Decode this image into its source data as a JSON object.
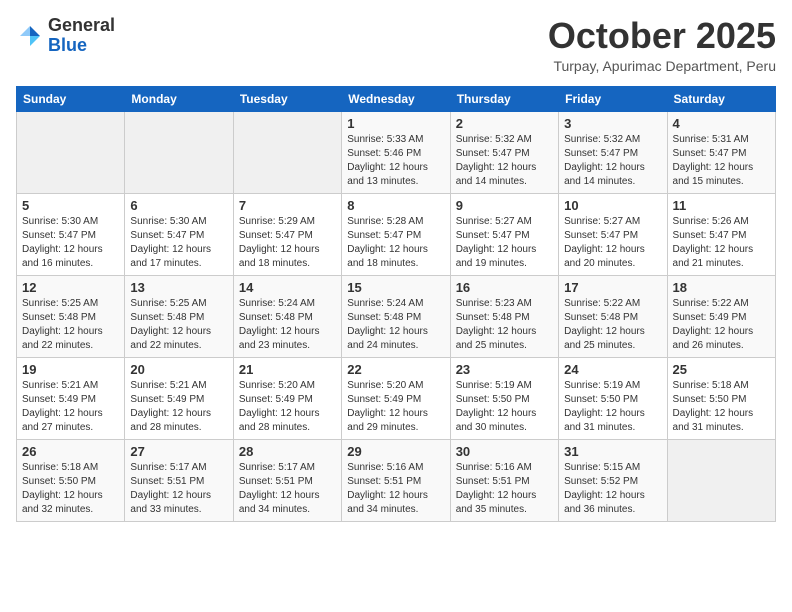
{
  "logo": {
    "general": "General",
    "blue": "Blue"
  },
  "header": {
    "month_title": "October 2025",
    "location": "Turpay, Apurimac Department, Peru"
  },
  "days_of_week": [
    "Sunday",
    "Monday",
    "Tuesday",
    "Wednesday",
    "Thursday",
    "Friday",
    "Saturday"
  ],
  "weeks": [
    [
      {
        "day": "",
        "info": ""
      },
      {
        "day": "",
        "info": ""
      },
      {
        "day": "",
        "info": ""
      },
      {
        "day": "1",
        "info": "Sunrise: 5:33 AM\nSunset: 5:46 PM\nDaylight: 12 hours\nand 13 minutes."
      },
      {
        "day": "2",
        "info": "Sunrise: 5:32 AM\nSunset: 5:47 PM\nDaylight: 12 hours\nand 14 minutes."
      },
      {
        "day": "3",
        "info": "Sunrise: 5:32 AM\nSunset: 5:47 PM\nDaylight: 12 hours\nand 14 minutes."
      },
      {
        "day": "4",
        "info": "Sunrise: 5:31 AM\nSunset: 5:47 PM\nDaylight: 12 hours\nand 15 minutes."
      }
    ],
    [
      {
        "day": "5",
        "info": "Sunrise: 5:30 AM\nSunset: 5:47 PM\nDaylight: 12 hours\nand 16 minutes."
      },
      {
        "day": "6",
        "info": "Sunrise: 5:30 AM\nSunset: 5:47 PM\nDaylight: 12 hours\nand 17 minutes."
      },
      {
        "day": "7",
        "info": "Sunrise: 5:29 AM\nSunset: 5:47 PM\nDaylight: 12 hours\nand 18 minutes."
      },
      {
        "day": "8",
        "info": "Sunrise: 5:28 AM\nSunset: 5:47 PM\nDaylight: 12 hours\nand 18 minutes."
      },
      {
        "day": "9",
        "info": "Sunrise: 5:27 AM\nSunset: 5:47 PM\nDaylight: 12 hours\nand 19 minutes."
      },
      {
        "day": "10",
        "info": "Sunrise: 5:27 AM\nSunset: 5:47 PM\nDaylight: 12 hours\nand 20 minutes."
      },
      {
        "day": "11",
        "info": "Sunrise: 5:26 AM\nSunset: 5:47 PM\nDaylight: 12 hours\nand 21 minutes."
      }
    ],
    [
      {
        "day": "12",
        "info": "Sunrise: 5:25 AM\nSunset: 5:48 PM\nDaylight: 12 hours\nand 22 minutes."
      },
      {
        "day": "13",
        "info": "Sunrise: 5:25 AM\nSunset: 5:48 PM\nDaylight: 12 hours\nand 22 minutes."
      },
      {
        "day": "14",
        "info": "Sunrise: 5:24 AM\nSunset: 5:48 PM\nDaylight: 12 hours\nand 23 minutes."
      },
      {
        "day": "15",
        "info": "Sunrise: 5:24 AM\nSunset: 5:48 PM\nDaylight: 12 hours\nand 24 minutes."
      },
      {
        "day": "16",
        "info": "Sunrise: 5:23 AM\nSunset: 5:48 PM\nDaylight: 12 hours\nand 25 minutes."
      },
      {
        "day": "17",
        "info": "Sunrise: 5:22 AM\nSunset: 5:48 PM\nDaylight: 12 hours\nand 25 minutes."
      },
      {
        "day": "18",
        "info": "Sunrise: 5:22 AM\nSunset: 5:49 PM\nDaylight: 12 hours\nand 26 minutes."
      }
    ],
    [
      {
        "day": "19",
        "info": "Sunrise: 5:21 AM\nSunset: 5:49 PM\nDaylight: 12 hours\nand 27 minutes."
      },
      {
        "day": "20",
        "info": "Sunrise: 5:21 AM\nSunset: 5:49 PM\nDaylight: 12 hours\nand 28 minutes."
      },
      {
        "day": "21",
        "info": "Sunrise: 5:20 AM\nSunset: 5:49 PM\nDaylight: 12 hours\nand 28 minutes."
      },
      {
        "day": "22",
        "info": "Sunrise: 5:20 AM\nSunset: 5:49 PM\nDaylight: 12 hours\nand 29 minutes."
      },
      {
        "day": "23",
        "info": "Sunrise: 5:19 AM\nSunset: 5:50 PM\nDaylight: 12 hours\nand 30 minutes."
      },
      {
        "day": "24",
        "info": "Sunrise: 5:19 AM\nSunset: 5:50 PM\nDaylight: 12 hours\nand 31 minutes."
      },
      {
        "day": "25",
        "info": "Sunrise: 5:18 AM\nSunset: 5:50 PM\nDaylight: 12 hours\nand 31 minutes."
      }
    ],
    [
      {
        "day": "26",
        "info": "Sunrise: 5:18 AM\nSunset: 5:50 PM\nDaylight: 12 hours\nand 32 minutes."
      },
      {
        "day": "27",
        "info": "Sunrise: 5:17 AM\nSunset: 5:51 PM\nDaylight: 12 hours\nand 33 minutes."
      },
      {
        "day": "28",
        "info": "Sunrise: 5:17 AM\nSunset: 5:51 PM\nDaylight: 12 hours\nand 34 minutes."
      },
      {
        "day": "29",
        "info": "Sunrise: 5:16 AM\nSunset: 5:51 PM\nDaylight: 12 hours\nand 34 minutes."
      },
      {
        "day": "30",
        "info": "Sunrise: 5:16 AM\nSunset: 5:51 PM\nDaylight: 12 hours\nand 35 minutes."
      },
      {
        "day": "31",
        "info": "Sunrise: 5:15 AM\nSunset: 5:52 PM\nDaylight: 12 hours\nand 36 minutes."
      },
      {
        "day": "",
        "info": ""
      }
    ]
  ]
}
